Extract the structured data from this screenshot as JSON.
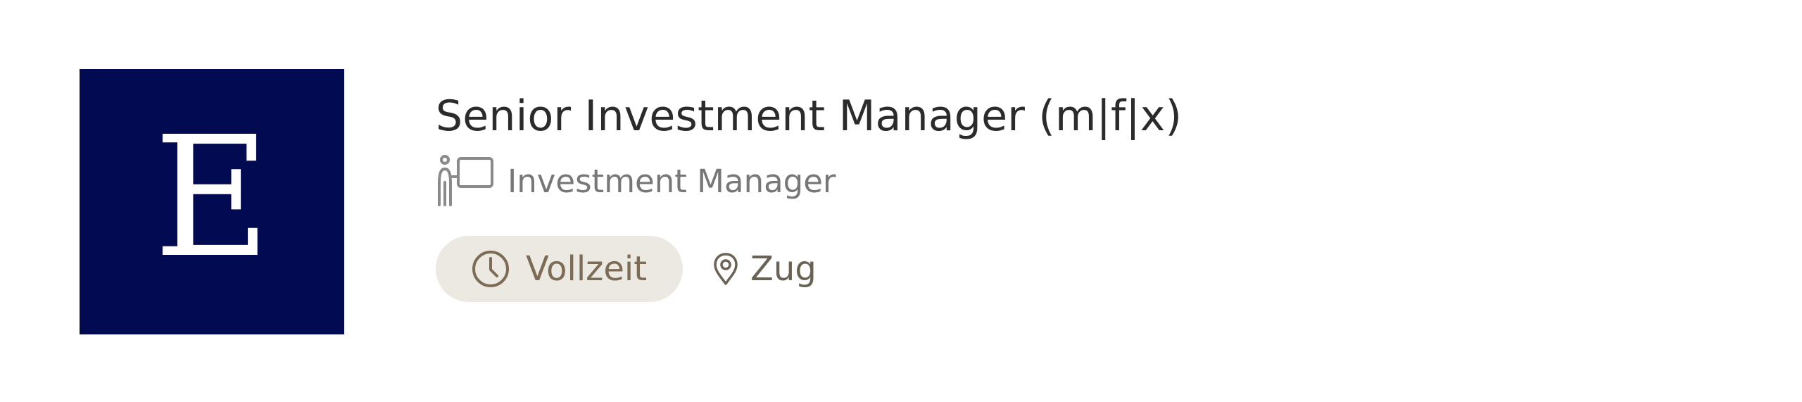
{
  "job": {
    "logo_letter": "E",
    "title": "Senior Investment Manager (m|f|x)",
    "category": {
      "icon": "presenter-board-icon",
      "label": "Investment Manager"
    },
    "employment_type": {
      "icon": "clock-icon",
      "label": "Vollzeit"
    },
    "location": {
      "icon": "location-pin-icon",
      "label": "Zug"
    }
  },
  "colors": {
    "logo_background": "#020a52",
    "title_text": "#2b2b2b",
    "category_text": "#777777",
    "chip_background": "#ece9e3",
    "chip_text": "#7d6c55",
    "location_text": "#6a6254"
  }
}
